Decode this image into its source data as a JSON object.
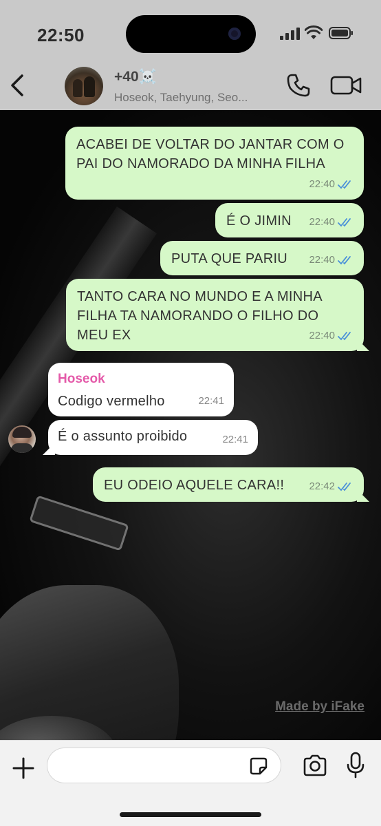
{
  "status_bar": {
    "time": "22:50",
    "icons": [
      "cellular-signal-icon",
      "wifi-icon",
      "battery-icon"
    ]
  },
  "header": {
    "back_icon": "chevron-left-icon",
    "title": "+40☠️",
    "subtitle": "Hoseok, Taehyung, Seo...",
    "call_icon": "phone-icon",
    "video_icon": "video-camera-icon"
  },
  "messages": [
    {
      "direction": "out",
      "text": "ACABEI DE VOLTAR DO JANTAR COM O PAI DO NAMORADO DA MINHA FILHA",
      "time": "22:40",
      "status": "read"
    },
    {
      "direction": "out",
      "text": "É O JIMIN",
      "time": "22:40",
      "status": "read"
    },
    {
      "direction": "out",
      "text": "PUTA QUE PARIU",
      "time": "22:40",
      "status": "read"
    },
    {
      "direction": "out",
      "text": "TANTO CARA NO MUNDO E A MINHA FILHA TA NAMORANDO O FILHO DO MEU EX",
      "time": "22:40",
      "status": "read"
    },
    {
      "direction": "in",
      "sender": "Hoseok",
      "text": "Codigo vermelho",
      "time": "22:41"
    },
    {
      "direction": "in",
      "text": "É o assunto proibido",
      "time": "22:41"
    },
    {
      "direction": "out",
      "text": "EU ODEIO AQUELE CARA!!",
      "time": "22:42",
      "status": "read"
    }
  ],
  "watermark": "Made by iFake",
  "composer": {
    "input_value": "",
    "icons": [
      "plus-icon",
      "sticker-icon",
      "camera-icon",
      "microphone-icon"
    ]
  },
  "colors": {
    "outgoing_bubble": "#d6f8c8",
    "incoming_bubble": "#ffffff",
    "sender_name": "#e45aa9",
    "read_ticks": "#4a90d9"
  }
}
